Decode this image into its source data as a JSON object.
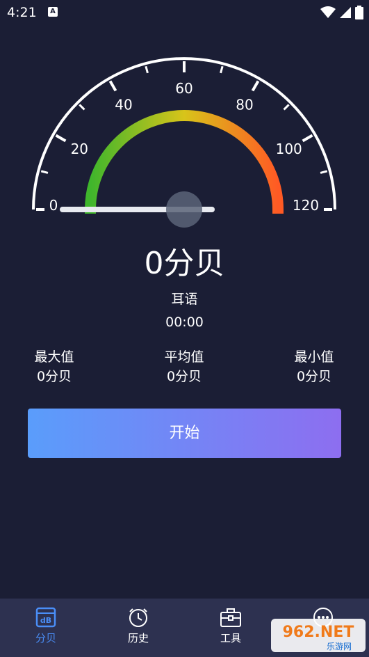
{
  "status_bar": {
    "time": "4:21",
    "notification_icon": "a-badge-icon",
    "wifi_icon": "wifi-icon",
    "signal_icon": "signal-icon",
    "battery_icon": "battery-icon"
  },
  "gauge": {
    "tick_labels": [
      "0",
      "20",
      "40",
      "60",
      "80",
      "100",
      "120"
    ],
    "min": 0,
    "max": 120,
    "current_value": 0,
    "colors": {
      "arc_start": "#3fb62c",
      "arc_mid": "#d8c41a",
      "arc_end": "#ff5a24",
      "needle": "#e8eaf0",
      "hub": "#5a6478"
    }
  },
  "reading": {
    "text": "0分贝"
  },
  "level_label": "耳语",
  "timer": "00:00",
  "stats": {
    "max": {
      "label": "最大值",
      "value": "0分贝"
    },
    "avg": {
      "label": "平均值",
      "value": "0分贝"
    },
    "min": {
      "label": "最小值",
      "value": "0分贝"
    }
  },
  "start_button": {
    "label": "开始"
  },
  "bottom_nav": {
    "items": [
      {
        "label": "分贝",
        "icon": "decibel-icon",
        "active": true
      },
      {
        "label": "历史",
        "icon": "clock-icon",
        "active": false
      },
      {
        "label": "工具",
        "icon": "toolbox-icon",
        "active": false
      },
      {
        "label": "",
        "icon": "more-icon",
        "active": false
      }
    ]
  },
  "watermark": {
    "text": "962.NET",
    "subtext": "乐游网"
  },
  "colors": {
    "background": "#1b1e35",
    "nav_background": "#2d3150",
    "accent": "#4a8ef7"
  }
}
